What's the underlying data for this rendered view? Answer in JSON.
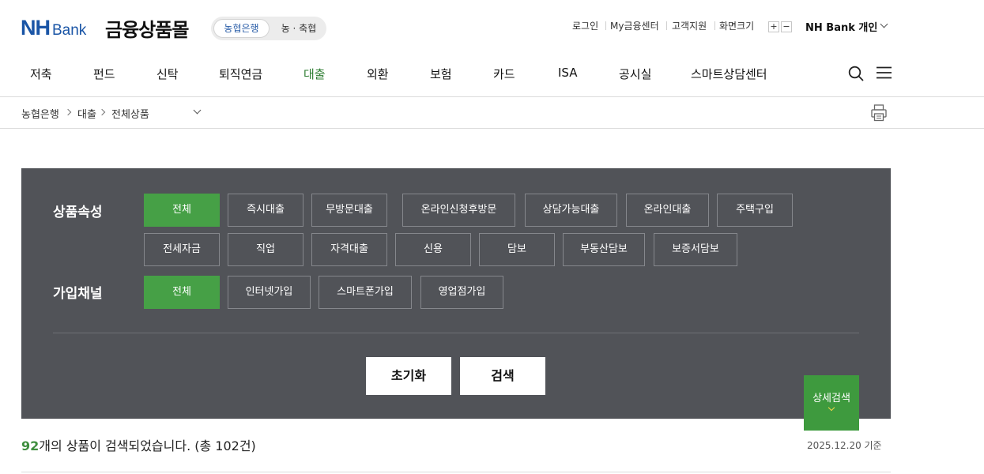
{
  "brand": {
    "logo_nh": "NH",
    "logo_bank": "Bank",
    "mall_title": "금융상품몰",
    "segment_active": "농협은행",
    "segment_other": "농 · 축협"
  },
  "util_links": [
    "로그인",
    "My금융센터",
    "고객지원",
    "화면크기"
  ],
  "zoom": {
    "plus": "+",
    "minus": "−"
  },
  "account_label": "NH Bank 개인",
  "gnb": {
    "items": [
      "저축",
      "펀드",
      "신탁",
      "퇴직연금",
      "대출",
      "외환",
      "보험",
      "카드",
      "ISA",
      "공시실",
      "스마트상담센터"
    ],
    "active": "대출"
  },
  "breadcrumb": [
    "농협은행",
    "대출",
    "전체상품"
  ],
  "filters": {
    "attr_label": "상품속성",
    "attr_options": [
      "전체",
      "즉시대출",
      "무방문대출",
      "온라인신청후방문",
      "상담가능대출",
      "온라인대출",
      "주택구입",
      "전세자금",
      "직업",
      "자격대출",
      "신용",
      "담보",
      "부동산담보",
      "보증서담보"
    ],
    "attr_selected": "전체",
    "channel_label": "가입채널",
    "channel_options": [
      "전체",
      "인터넷가입",
      "스마트폰가입",
      "영업점가입"
    ],
    "channel_selected": "전체",
    "reset_label": "초기화",
    "search_label": "검색",
    "detail_label": "상세검색"
  },
  "result": {
    "count": "92",
    "text": "개의 상품이 검색되었습니다. (총 102건)",
    "basis_date": "2025.12.20 기준"
  },
  "colors": {
    "accent_green": "#46a046",
    "brand_blue": "#1a55a6",
    "panel_bg": "#515358"
  }
}
